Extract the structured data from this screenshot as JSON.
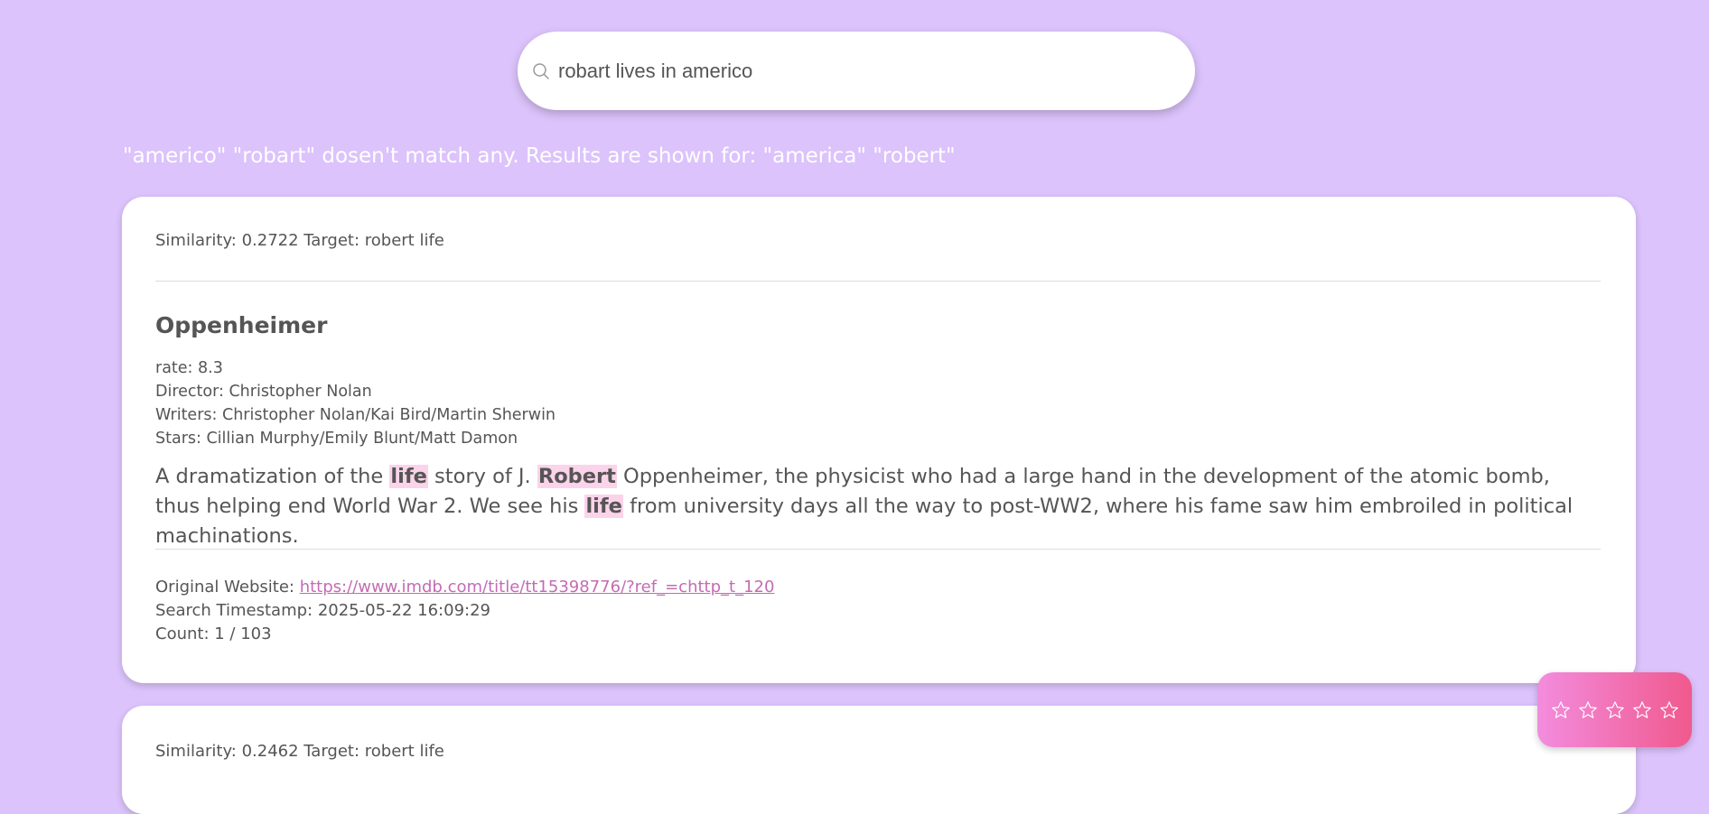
{
  "search": {
    "value": "robart lives in americo",
    "placeholder": ""
  },
  "notice": "\"americo\" \"robart\" dosen't match any. Results are shown for: \"america\" \"robert\"",
  "results": [
    {
      "meta": "Similarity: 0.2722 Target: robert life",
      "title": "Oppenheimer",
      "rate": "rate: 8.3",
      "director": "Director: Christopher Nolan",
      "writers": "Writers: Christopher Nolan/Kai Bird/Martin Sherwin",
      "stars": "Stars: Cillian Murphy/Emily Blunt/Matt Damon",
      "description": {
        "p1": "A dramatization of the ",
        "h1": "life",
        "p2": " story of J. ",
        "h2": "Robert",
        "p3": " Oppenheimer, the physicist who had a large hand in the development of the atomic bomb, thus helping end World War 2. We see his ",
        "h3": "life",
        "p4": " from university days all the way to post-WW2, where his fame saw him embroiled in political machinations."
      },
      "website_label": "Original Website: ",
      "website_url": "https://www.imdb.com/title/tt15398776/?ref_=chttp_t_120",
      "timestamp": "Search Timestamp: 2025-05-22 16:09:29",
      "count": "Count: 1 / 103"
    },
    {
      "meta": "Similarity: 0.2462 Target: robert life"
    }
  ],
  "rating": {
    "stars_filled": 0,
    "stars_total": 5
  },
  "colors": {
    "background": "#dcc3fb",
    "highlight": "#fbd3ea",
    "link": "#c46bb4",
    "rating_gradient_start": "#f38cde",
    "rating_gradient_end": "#f0598d"
  }
}
